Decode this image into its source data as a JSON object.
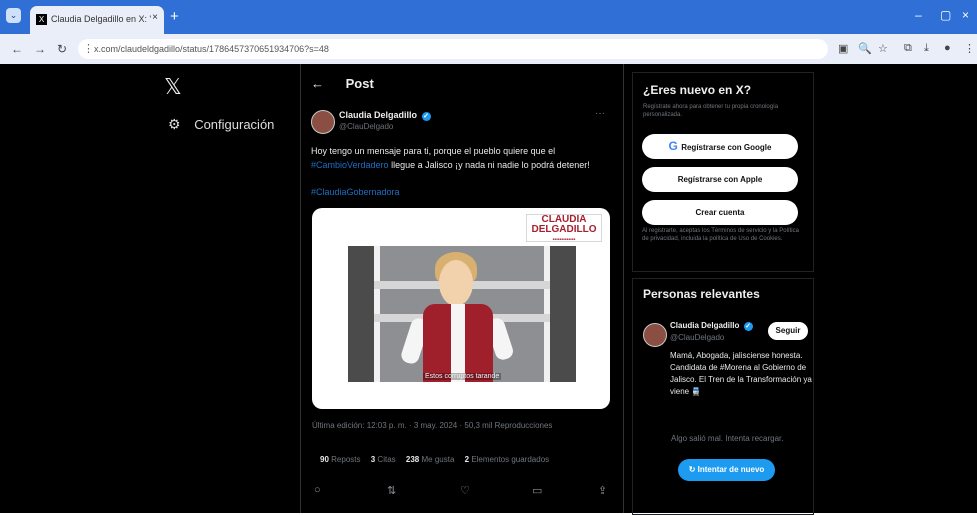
{
  "browser": {
    "tab_title": "Claudia Delgadillo en X: \"H",
    "tab_favicon": "X",
    "url": "x.com/claudeldgadillo/status/1786457370651934706?s=48"
  },
  "left": {
    "logo": "𝕏",
    "settings_label": "Configuración"
  },
  "post": {
    "header": "Post",
    "author_name": "Claudia Delgadillo",
    "author_handle": "@ClauDelgado",
    "text_before": "Hoy tengo un mensaje para ti, porque el pueblo quiere que el ",
    "hashtag_inline": "#CambioVerdadero",
    "text_after": " llegue a Jalisco ¡y nada ni nadie lo podrá detener!",
    "hashtag_standalone": "#ClaudiaGobernadora",
    "media_banner": "CLAUDIA DELGADILLO",
    "media_subtitle": "Estos corruptos tarande",
    "meta": "Última edición: 12:03 p. m. · 3 may. 2024 · 50,3 mil Reproducciones",
    "stats": {
      "reposts": "90",
      "reposts_label": "Reposts",
      "quotes": "3",
      "quotes_label": "Citas",
      "likes": "238",
      "likes_label": "Me gusta",
      "bookmarks": "2",
      "bookmarks_label": "Elementos guardados"
    }
  },
  "signup": {
    "title": "¿Eres nuevo en X?",
    "subtitle": "Regístrate ahora para obtener tu propia cronología personalizada.",
    "google_button": "Regístrarse con Google",
    "apple_button": "Regístrarse con Apple",
    "create_button": "Crear cuenta",
    "legal_text": "Al registrarte, aceptas los Términos de servicio y la Política de privacidad, incluida la política de Uso de Cookies."
  },
  "relevant": {
    "title": "Personas relevantes",
    "name": "Claudia Delgadillo",
    "handle": "@ClauDelgado",
    "follow_button": "Seguir",
    "bio": "Mamá, Abogada, jalisciense honesta. Candidata de #Morena al Gobierno de Jalisco. El Tren de la Transformación ya viene 🚆",
    "error": "Algo salió mal. Intenta recargar.",
    "retry_button": "Intentar de nuevo"
  }
}
